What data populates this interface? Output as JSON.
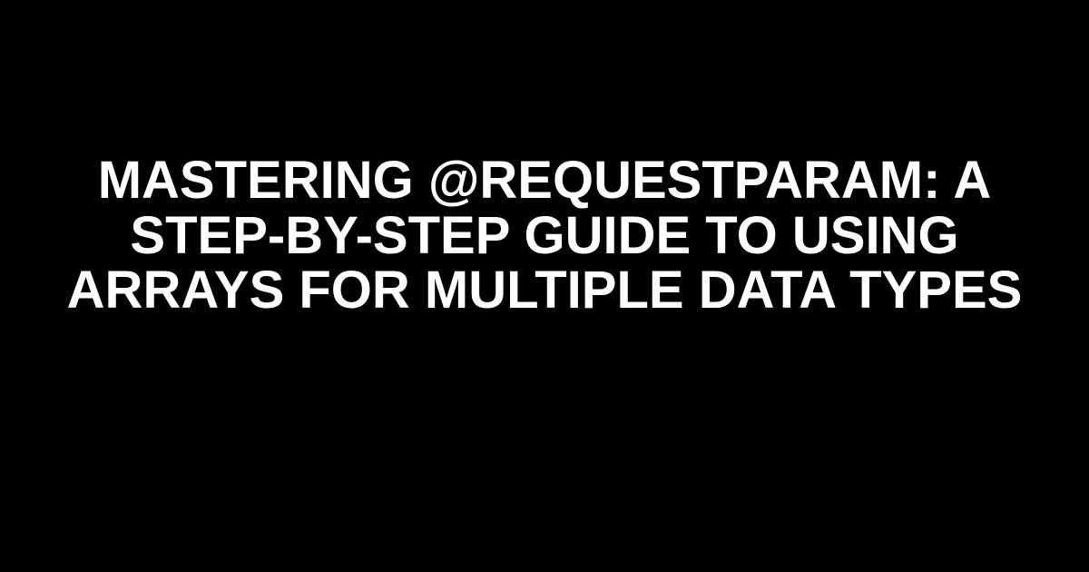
{
  "document": {
    "title": "MASTERING @REQUESTPARAM: A STEP-BY-STEP GUIDE TO USING ARRAYS FOR MULTIPLE DATA TYPES"
  }
}
